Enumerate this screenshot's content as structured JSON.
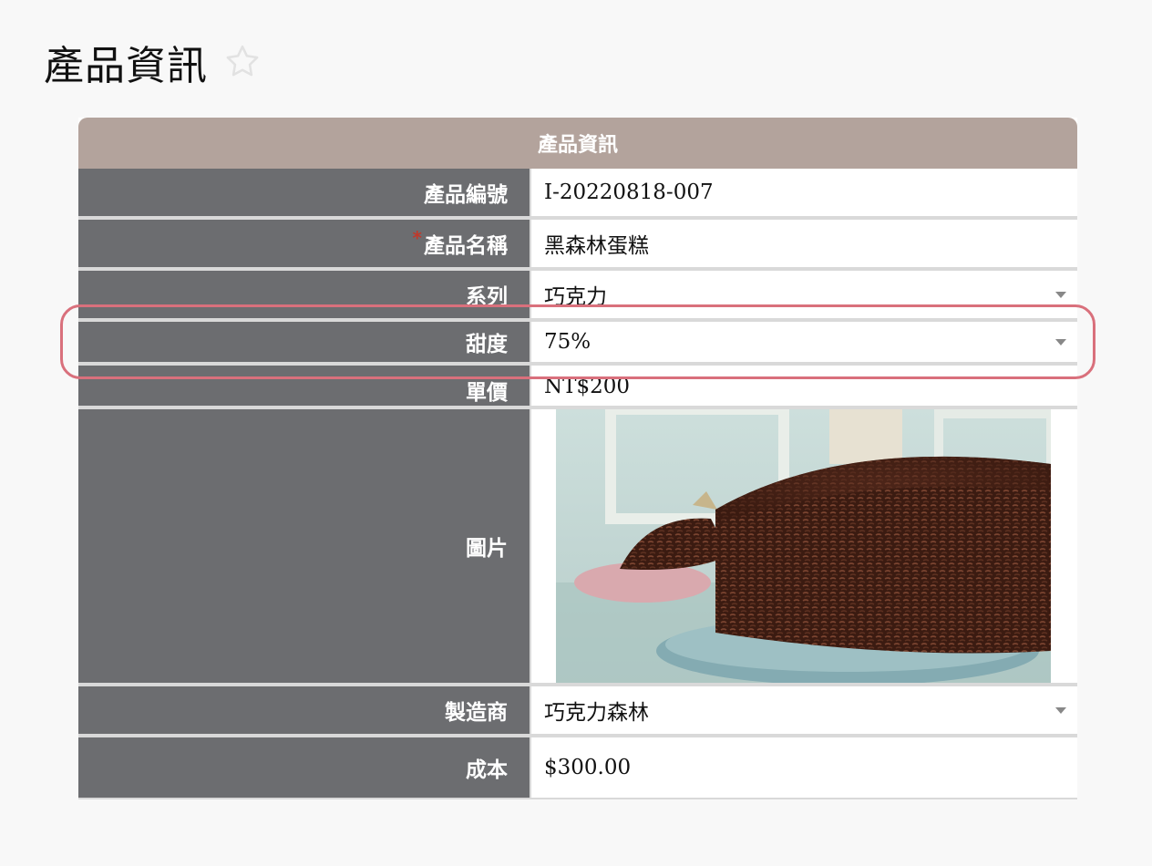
{
  "page": {
    "title": "產品資訊"
  },
  "form": {
    "section_title": "產品資訊",
    "fields": [
      {
        "label": "產品編號",
        "value": "I-20220818-007",
        "required": false
      },
      {
        "label": "產品名稱",
        "value": "黑森林蛋糕",
        "required": true
      },
      {
        "label": "系列",
        "value": "巧克力",
        "type": "select"
      },
      {
        "label": "甜度",
        "value": "75%",
        "type": "select"
      },
      {
        "label": "單價",
        "value": "NT$200"
      },
      {
        "label": "圖片"
      },
      {
        "label": "製造商",
        "value": "巧克力森林",
        "type": "select"
      },
      {
        "label": "成本",
        "value": "$300.00"
      }
    ],
    "required_mark": "*"
  },
  "colors": {
    "header_bg": "#b3a39c",
    "label_bg": "#6c6d70",
    "highlight": "#d9707c",
    "required": "#c0392b"
  }
}
